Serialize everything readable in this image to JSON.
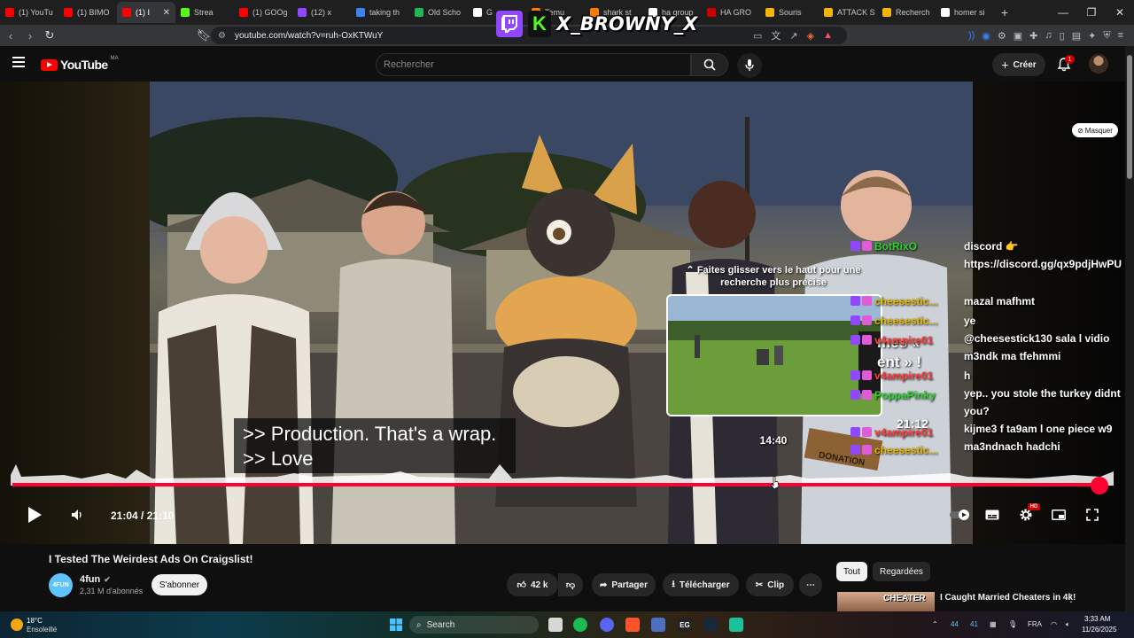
{
  "browser": {
    "tabs": [
      {
        "label": "(1) YouTu",
        "color": "#ff0000"
      },
      {
        "label": "(1) BIMO",
        "color": "#ff0000"
      },
      {
        "label": "(1) I",
        "color": "#ff0000",
        "active": true
      },
      {
        "label": "Strea",
        "color": "#53fc18"
      },
      {
        "label": "(1) GOOg",
        "color": "#ff0000"
      },
      {
        "label": "(12) x",
        "color": "#9146ff"
      },
      {
        "label": "taking th",
        "color": "#3b82f6"
      },
      {
        "label": "Old Scho",
        "color": "#1db954"
      },
      {
        "label": "G",
        "color": "#ffffff"
      },
      {
        "label": "Temu",
        "color": "#ff7a00"
      },
      {
        "label": "shark st",
        "color": "#ff7a00"
      },
      {
        "label": "ha group",
        "color": "#ffffff"
      },
      {
        "label": "HA GRO",
        "color": "#cc0000"
      },
      {
        "label": "Souris",
        "color": "#f4b400"
      },
      {
        "label": "ATTACK S",
        "color": "#f4b400"
      },
      {
        "label": "Recherch",
        "color": "#f4b400"
      },
      {
        "label": "homer si",
        "color": "#ffffff"
      }
    ],
    "url": "youtube.com/watch?v=ruh-OxKTWuY"
  },
  "overlay": {
    "streamer_name": "X_BROWNY_X",
    "kick_letter": "K"
  },
  "youtube": {
    "logo_text": "YouTube",
    "logo_region": "MA",
    "search_placeholder": "Rechercher",
    "create_label": "Créer",
    "notif_count": "1"
  },
  "player": {
    "hide_label": "Masquer",
    "captions": [
      ">> Production. That's a wrap.",
      ">> Love"
    ],
    "seek_tip": "Faites glisser vers le haut pour une recherche plus précise",
    "preview_time": "14:40",
    "time_current": "21:04",
    "time_total": "21:10",
    "progress": 0.995,
    "hd_label": "HD",
    "preview_overlay_text": [
      "mes «",
      "ent » !",
      "21:12"
    ]
  },
  "chat": [
    {
      "user": "BotRixO",
      "color": "#2fd12f",
      "msg": "discord 👉 https://discord.gg/qx9pdjHwPU"
    },
    {
      "user": "cheesestic...",
      "color": "#e6b800",
      "msg": "mazal mafhmt"
    },
    {
      "user": "cheesestic...",
      "color": "#e6b800",
      "msg": "ye"
    },
    {
      "user": "v4ampire01",
      "color": "#ff3c3c",
      "msg": "@cheesestick130 sala l vidio m3ndk ma tfehmmi"
    },
    {
      "user": "v4ampire01",
      "color": "#ff3c3c",
      "msg": "h"
    },
    {
      "user": "PoppaPinky",
      "color": "#2fd12f",
      "msg": "yep.. you stole the turkey didnt you?"
    },
    {
      "user": "v4ampire01",
      "color": "#ff3c3c",
      "msg": "kijme3 f ta9am l one piece w9 ma3ndnach hadchi"
    },
    {
      "user": "cheesestic...",
      "color": "#e6b800",
      "msg": ""
    }
  ],
  "video": {
    "title": "I Tested The Weirdest Ads On Craigslist!",
    "channel": "4fun",
    "channel_avatar_text": "4FUN",
    "subscribers": "2,31 M d'abonnés",
    "subscribe_label": "S'abonner",
    "likes": "42 k",
    "share_label": "Partager",
    "download_label": "Télécharger",
    "clip_label": "Clip"
  },
  "sidebar": {
    "chips": [
      "Tout",
      "Regardées"
    ],
    "recommendation_title": "I Caught Married Cheaters in 4k!",
    "recommendation_thumb_text": "CHEATER"
  },
  "taskbar": {
    "temperature": "18°C",
    "condition": "Ensoleillé",
    "search_label": "Search",
    "lang": "FRA",
    "time": "3:33 AM",
    "date": "11/26/2025",
    "tray_nums": [
      "44",
      "41"
    ]
  }
}
